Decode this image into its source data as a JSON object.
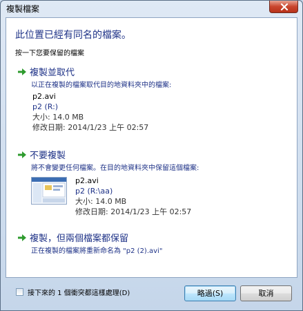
{
  "window": {
    "title": "複製檔案"
  },
  "header": {
    "heading": "此位置已經有同名的檔案。",
    "subheading": "按一下您要保留的檔案"
  },
  "options": [
    {
      "title": "複製並取代",
      "description": "以正在複製的檔案取代目的地資料夾中的檔案:",
      "file_name": "p2.avi",
      "file_location": "p2 (R:)",
      "file_size": "大小: 14.0 MB",
      "file_date": "修改日期: 2014/1/23 上午 02:57"
    },
    {
      "title": "不要複製",
      "description": "將不會變更任何檔案。在目的地資料夾中保留這個檔案:",
      "file_name": "p2.avi",
      "file_location": "p2 (R:\\aa)",
      "file_size": "大小: 14.0 MB",
      "file_date": "修改日期: 2014/1/23 上午 02:57"
    },
    {
      "title": "複製，但兩個檔案都保留",
      "description": "正在複製的檔案將重新命名為 \"p2 (2).avi\""
    }
  ],
  "footer": {
    "checkbox_label": "接下來的 1 個衝突都這樣處理(D)",
    "checkbox_checked": false,
    "skip_label": "略過(S)",
    "cancel_label": "取消"
  },
  "colors": {
    "link_blue": "#1e3287",
    "arrow_green": "#2e9b2e"
  },
  "icons": {
    "option_arrow": "green-arrow-icon",
    "close": "close-icon",
    "thumbnail": "video-thumbnail-icon"
  }
}
